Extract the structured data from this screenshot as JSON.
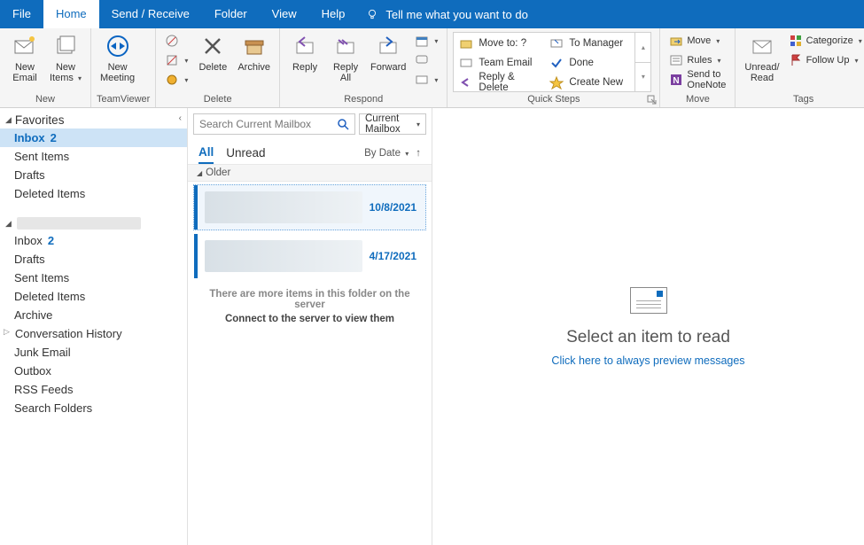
{
  "tabs": {
    "file": "File",
    "home": "Home",
    "send_receive": "Send / Receive",
    "folder": "Folder",
    "view": "View",
    "help": "Help",
    "tell_me": "Tell me what you want to do"
  },
  "ribbon": {
    "new": {
      "label": "New",
      "new_email": "New\nEmail",
      "new_items": "New\nItems"
    },
    "teamviewer": {
      "label": "TeamViewer",
      "new_meeting": "New\nMeeting"
    },
    "delete": {
      "label": "Delete",
      "delete": "Delete",
      "archive": "Archive"
    },
    "respond": {
      "label": "Respond",
      "reply": "Reply",
      "reply_all": "Reply\nAll",
      "forward": "Forward"
    },
    "quick_steps": {
      "label": "Quick Steps",
      "items_left": [
        "Move to: ?",
        "Team Email",
        "Reply & Delete"
      ],
      "items_right": [
        "To Manager",
        "Done",
        "Create New"
      ]
    },
    "move": {
      "label": "Move",
      "move": "Move",
      "rules": "Rules",
      "onenote": "Send to OneNote"
    },
    "tags": {
      "label": "Tags",
      "unread_read": "Unread/\nRead",
      "categorize": "Categorize",
      "follow_up": "Follow Up"
    }
  },
  "nav": {
    "favorites": "Favorites",
    "fav_items": [
      {
        "label": "Inbox",
        "count": "2",
        "selected": true
      },
      {
        "label": "Sent Items"
      },
      {
        "label": "Drafts"
      },
      {
        "label": "Deleted Items"
      }
    ],
    "acct_items": [
      {
        "label": "Inbox",
        "count": "2"
      },
      {
        "label": "Drafts"
      },
      {
        "label": "Sent Items"
      },
      {
        "label": "Deleted Items"
      },
      {
        "label": "Archive"
      },
      {
        "label": "Conversation History",
        "expandable": true
      },
      {
        "label": "Junk Email"
      },
      {
        "label": "Outbox"
      },
      {
        "label": "RSS Feeds"
      },
      {
        "label": "Search Folders"
      }
    ]
  },
  "msglist": {
    "search_placeholder": "Search Current Mailbox",
    "scope": "Current Mailbox",
    "filters": {
      "all": "All",
      "unread": "Unread"
    },
    "sort": "By Date",
    "group": "Older",
    "items": [
      {
        "date": "10/8/2021",
        "selected": true
      },
      {
        "date": "4/17/2021"
      }
    ],
    "server_msg": "There are more items in this folder on the server",
    "server_link": "Connect to the server to view them"
  },
  "reading": {
    "title": "Select an item to read",
    "link": "Click here to always preview messages"
  }
}
